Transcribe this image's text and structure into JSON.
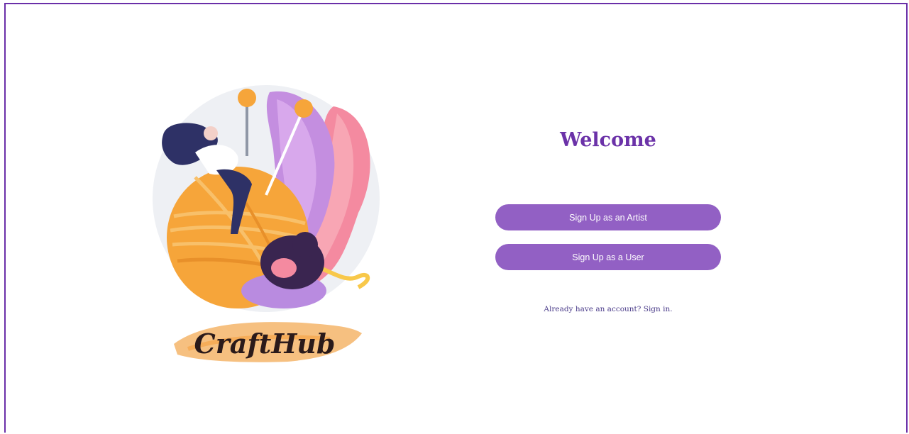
{
  "logo": {
    "text": "CraftHub"
  },
  "welcome": {
    "title": "Welcome"
  },
  "actions": {
    "artist_label": "Sign Up as an Artist",
    "user_label": "Sign Up as a User"
  },
  "signin": {
    "prompt": "Already have an account?",
    "link": "Sign in."
  },
  "colors": {
    "brand_purple": "#6b32a8",
    "button_purple": "#9260c4",
    "frame_border": "#6a2fa8"
  }
}
